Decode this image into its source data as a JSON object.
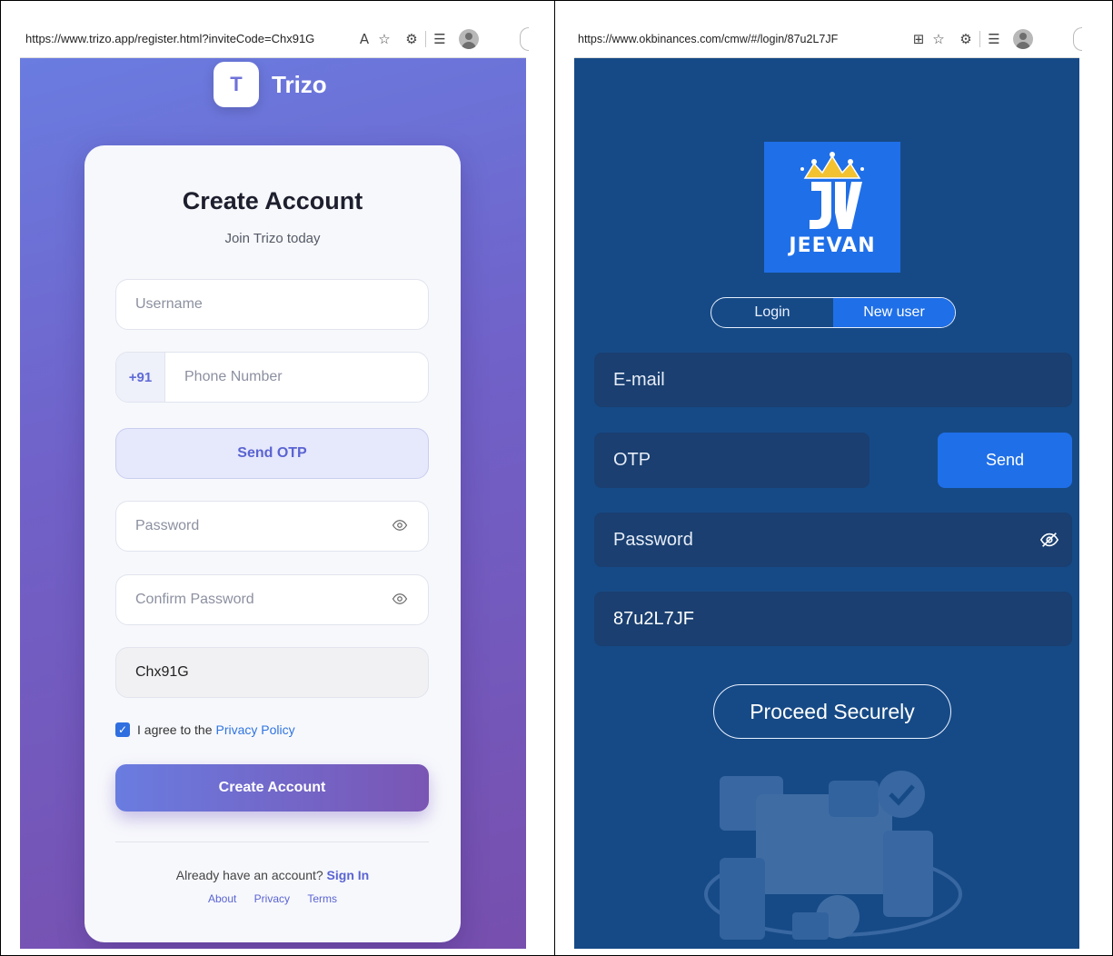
{
  "left": {
    "browser": {
      "url": "https://www.trizo.app/register.html?inviteCode=Chx91G"
    },
    "brand": {
      "logo_letter": "T",
      "name": "Trizo"
    },
    "card": {
      "title": "Create Account",
      "subtitle": "Join Trizo today",
      "username_placeholder": "Username",
      "country_code": "+91",
      "phone_placeholder": "Phone Number",
      "send_otp_label": "Send OTP",
      "password_placeholder": "Password",
      "confirm_password_placeholder": "Confirm Password",
      "invite_code_value": "Chx91G",
      "agree_text": "I agree to the",
      "privacy_link": "Privacy Policy",
      "agree_checked": true,
      "create_button": "Create Account",
      "already_text": "Already have an account?",
      "sign_in_link": "Sign In",
      "footer_links": [
        "About",
        "Privacy",
        "Terms"
      ]
    },
    "colors": {
      "gradient_start": "#6a7ce0",
      "gradient_end": "#774fae",
      "accent": "#5a64d2"
    }
  },
  "right": {
    "browser": {
      "url": "https://www.okbinances.com/cmw/#/login/87u2L7JF"
    },
    "brand": {
      "logo_text": "JEEVAN",
      "monogram": "JV"
    },
    "tabs": {
      "login": "Login",
      "new_user": "New user",
      "active": "New user"
    },
    "form": {
      "email_placeholder": "E-mail",
      "otp_placeholder": "OTP",
      "send_label": "Send",
      "password_placeholder": "Password",
      "invite_code_value": "87u2L7JF",
      "proceed_label": "Proceed Securely"
    },
    "colors": {
      "background": "#164a86",
      "field": "#1a3f70",
      "accent": "#1f6fe8"
    }
  }
}
